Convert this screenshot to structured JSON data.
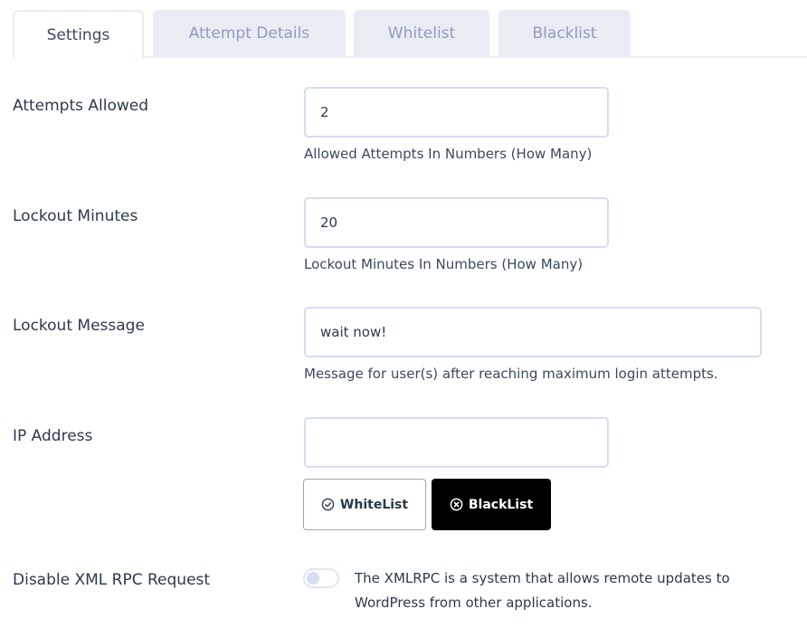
{
  "tabs": [
    {
      "label": "Settings",
      "active": true
    },
    {
      "label": "Attempt Details",
      "active": false
    },
    {
      "label": "Whitelist",
      "active": false
    },
    {
      "label": "Blacklist",
      "active": false
    }
  ],
  "fields": {
    "attempts_allowed": {
      "label": "Attempts Allowed",
      "value": "2",
      "help": "Allowed Attempts In Numbers (How Many)"
    },
    "lockout_minutes": {
      "label": "Lockout Minutes",
      "value": "20",
      "help": "Lockout Minutes In Numbers (How Many)"
    },
    "lockout_message": {
      "label": "Lockout Message",
      "value": "wait now!",
      "help": "Message for user(s) after reaching maximum login attempts."
    },
    "ip_address": {
      "label": "IP Address",
      "value": "",
      "whitelist_button": "WhiteList",
      "whitelist_icon": "check-circle-icon",
      "blacklist_button": "BlackList",
      "blacklist_icon": "x-circle-icon"
    },
    "xmlrpc": {
      "label": "Disable XML RPC Request",
      "enabled": false,
      "description": "The XMLRPC is a system that allows remote updates to WordPress from other applications."
    }
  }
}
